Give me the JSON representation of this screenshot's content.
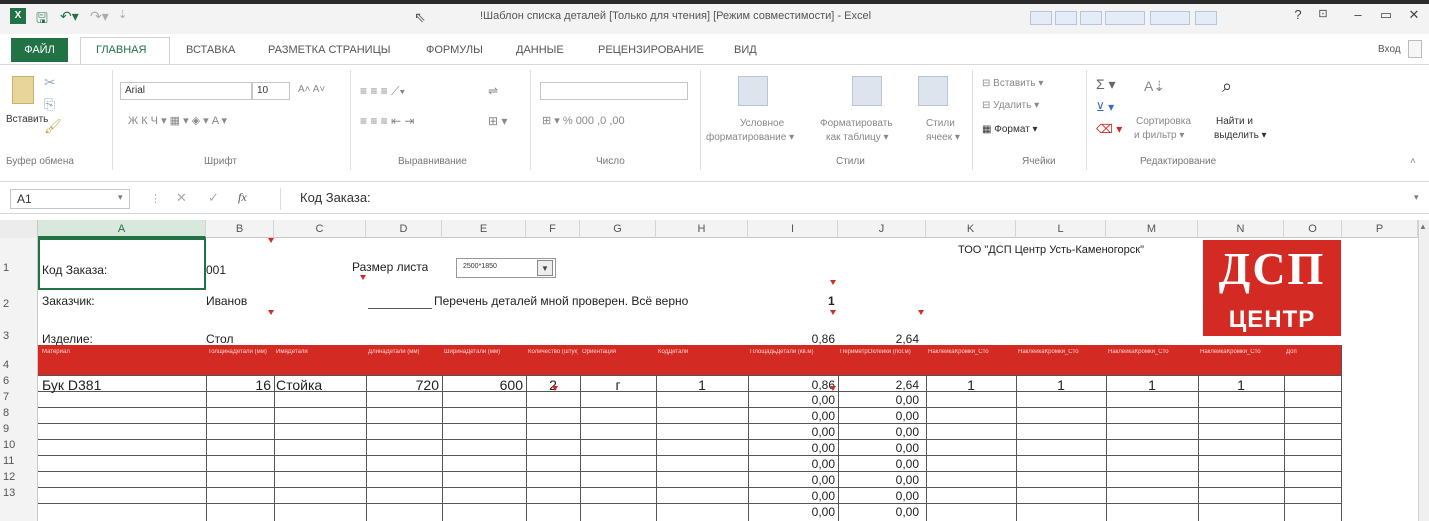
{
  "window": {
    "title": "!Шаблон списка деталей  [Только для чтения]  [Режим совместимости] - Excel",
    "help": "?",
    "minimize": "–",
    "restore": "▭",
    "close": "✕",
    "signin": "Вход"
  },
  "ribbon_tabs": [
    "ФАЙЛ",
    "ГЛАВНАЯ",
    "ВСТАВКА",
    "РАЗМЕТКА СТРАНИЦЫ",
    "ФОРМУЛЫ",
    "ДАННЫЕ",
    "РЕЦЕНЗИРОВАНИЕ",
    "ВИД"
  ],
  "ribbon": {
    "paste": "Вставить",
    "clipboard_group": "Буфер обмена",
    "font_name": "Arial",
    "font_size": "10",
    "font_group": "Шрифт",
    "align_group": "Выравнивание",
    "number_group": "Число",
    "cond_format": [
      "Условное",
      "форматирование ▾"
    ],
    "format_table": [
      "Форматировать",
      "как таблицу ▾"
    ],
    "cell_styles": [
      "Стили",
      "ячеек ▾"
    ],
    "styles_group": "Стили",
    "insert": "Вставить ▾",
    "delete": "Удалить ▾",
    "format": "Формат ▾",
    "cells_group": "Ячейки",
    "sort_filter": [
      "Сортировка",
      "и фильтр ▾"
    ],
    "find_select": [
      "Найти и",
      "выделить ▾"
    ],
    "editing_group": "Редактирование"
  },
  "formula_bar": {
    "name_box": "A1",
    "fx": "fx",
    "formula": "Код Заказа:"
  },
  "columns": [
    "A",
    "B",
    "C",
    "D",
    "E",
    "F",
    "G",
    "H",
    "I",
    "J",
    "K",
    "L",
    "M",
    "N",
    "O",
    "P"
  ],
  "rows": [
    "1",
    "2",
    "3",
    "4",
    "6",
    "7",
    "8",
    "9",
    "10",
    "11",
    "12",
    "13"
  ],
  "sheet": {
    "order_code_label": "Код Заказа:",
    "order_code": "001",
    "sheet_size_label": "Размер листа",
    "sheet_size_value": "2500*1850",
    "customer_label": "Заказчик:",
    "customer": "Иванов",
    "checked_text": "Перечень деталей мной проверен. Всё верно",
    "checked_value": "1",
    "product_label": "Изделие:",
    "product": "Стол",
    "total_area": "0,86",
    "total_perimeter": "2,64",
    "company": "ТОО \"ДСП Центр Усть-Каменогорск\"",
    "logo_top": "ДСП",
    "logo_bottom": "ЦЕНТР",
    "headers": [
      "Материал",
      "ТолщинаДетали (мм)",
      "ИмяДетали",
      "ДлинаДетали (мм)",
      "ШиринаДетали (мм)",
      "Количество (штук)",
      "Ориентация",
      "КодДетали",
      "ПлощадьДетали (кв.м)",
      "ПериметрОклейки (пог.м)",
      "НаклейкаКромки_Сто",
      "НаклейкаКромки_Сто",
      "НаклейкаКромки_Сто",
      "НаклейкаКромки_Сто",
      "Доп"
    ],
    "row6": {
      "material": "Бук D381",
      "thickness": "16",
      "name": "Стойка",
      "length": "720",
      "width": "600",
      "qty": "2",
      "orient": "г",
      "code": "1",
      "area": "0,86",
      "perimeter": "2,64",
      "edge1": "1",
      "edge2": "1",
      "edge3": "1",
      "edge4": "1"
    },
    "zero_area": "0,00",
    "zero_perimeter": "0,00"
  },
  "colors": {
    "excel_green": "#217346",
    "header_red": "#d42a24"
  }
}
